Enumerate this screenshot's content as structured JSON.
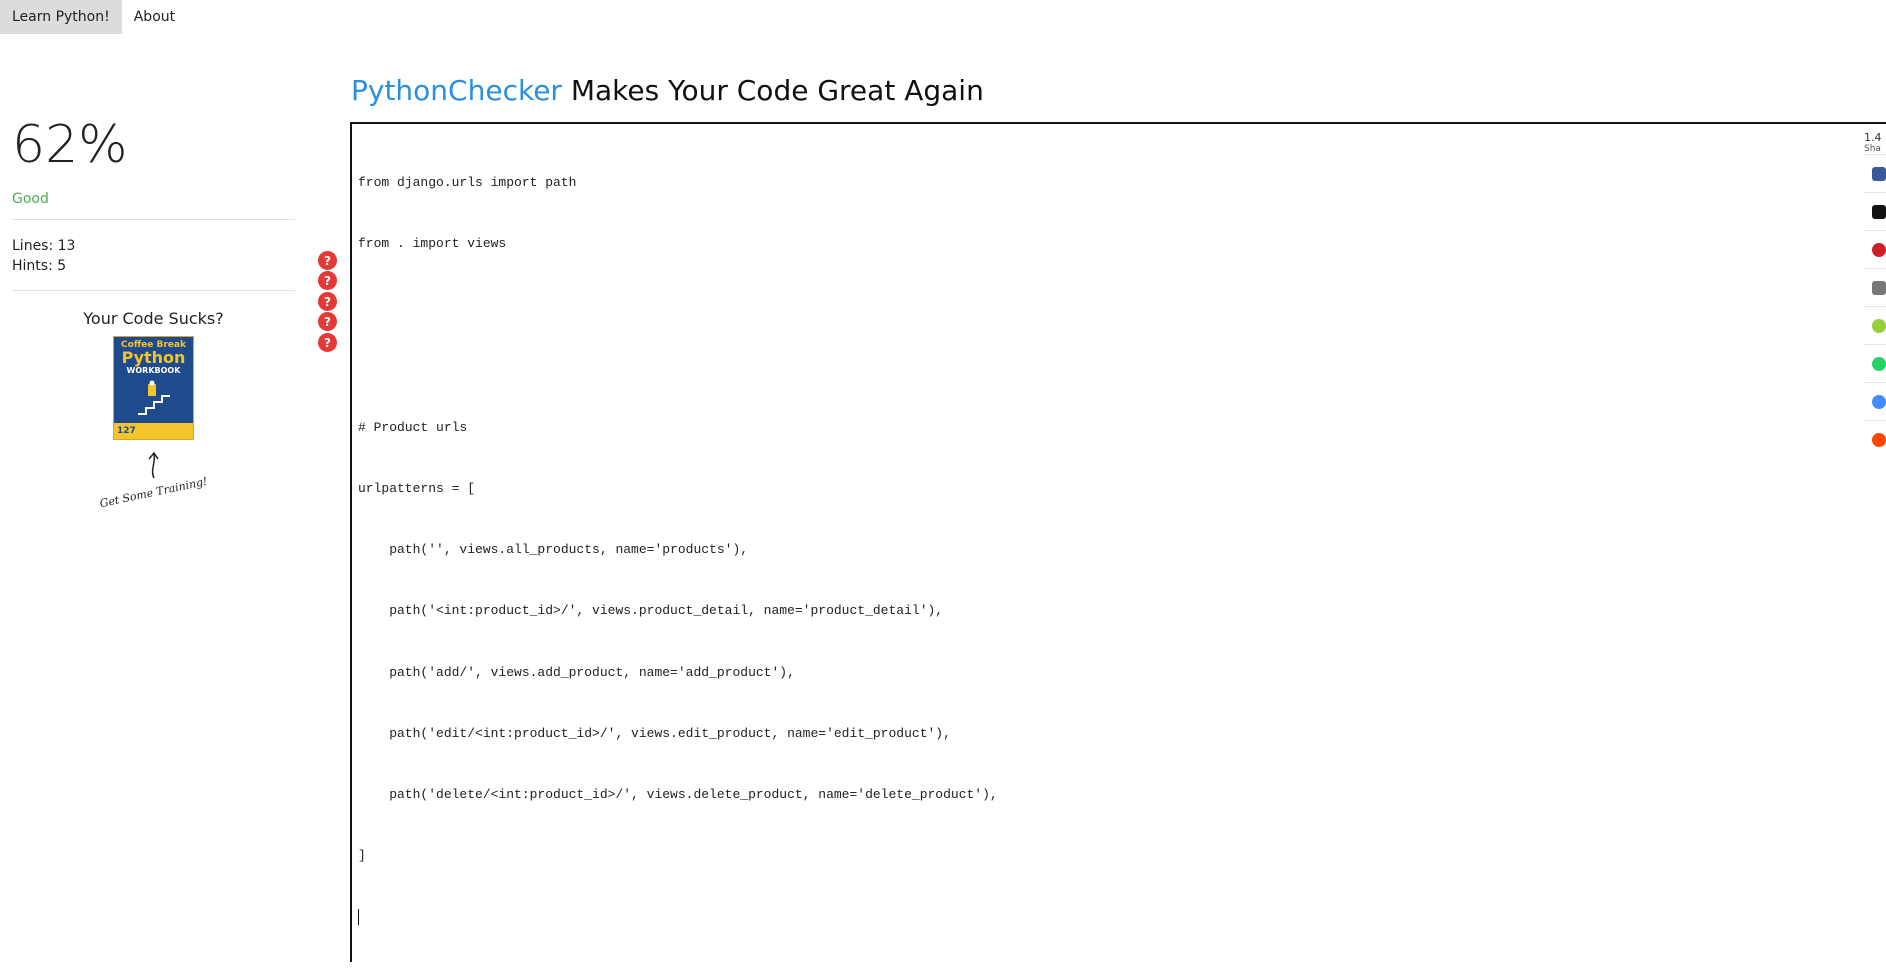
{
  "nav": {
    "items": [
      {
        "label": "Learn Python!",
        "active": true
      },
      {
        "label": "About",
        "active": false
      }
    ]
  },
  "sidebar": {
    "score": "62%",
    "score_label": "Good",
    "lines_text": "Lines: 13",
    "hints_text": "Hints: 5",
    "promo_title": "Your Code Sucks?",
    "book": {
      "top": "Coffee Break",
      "main": "Python",
      "sub": "WORKBOOK",
      "number": "127"
    },
    "training_text": "Get Some Training!"
  },
  "header": {
    "brand": "PythonChecker",
    "tagline": " Makes Your Code Great Again"
  },
  "editor": {
    "lines": [
      "from django.urls import path",
      "from . import views",
      "",
      "",
      "# Product urls",
      "urlpatterns = [",
      "    path('', views.all_products, name='products'),",
      "    path('<int:product_id>/', views.product_detail, name='product_detail'),",
      "    path('add/', views.add_product, name='add_product'),",
      "    path('edit/<int:product_id>/', views.edit_product, name='edit_product'),",
      "    path('delete/<int:product_id>/', views.delete_product, name='delete_product'),",
      "]"
    ],
    "hint_marker": "?"
  },
  "share": {
    "count": "1.4",
    "label": "Sha",
    "buttons": [
      {
        "icon": "facebook-icon",
        "color": "#3b5998"
      },
      {
        "icon": "x-icon",
        "color": "#111111"
      },
      {
        "icon": "pinterest-icon",
        "color": "#cb2027"
      },
      {
        "icon": "email-icon",
        "color": "#777777"
      },
      {
        "icon": "sharethis-icon",
        "color": "#95d03a"
      },
      {
        "icon": "whatsapp-icon",
        "color": "#25d366"
      },
      {
        "icon": "messenger-icon",
        "color": "#448aff"
      },
      {
        "icon": "reddit-icon",
        "color": "#ff4500"
      }
    ]
  }
}
